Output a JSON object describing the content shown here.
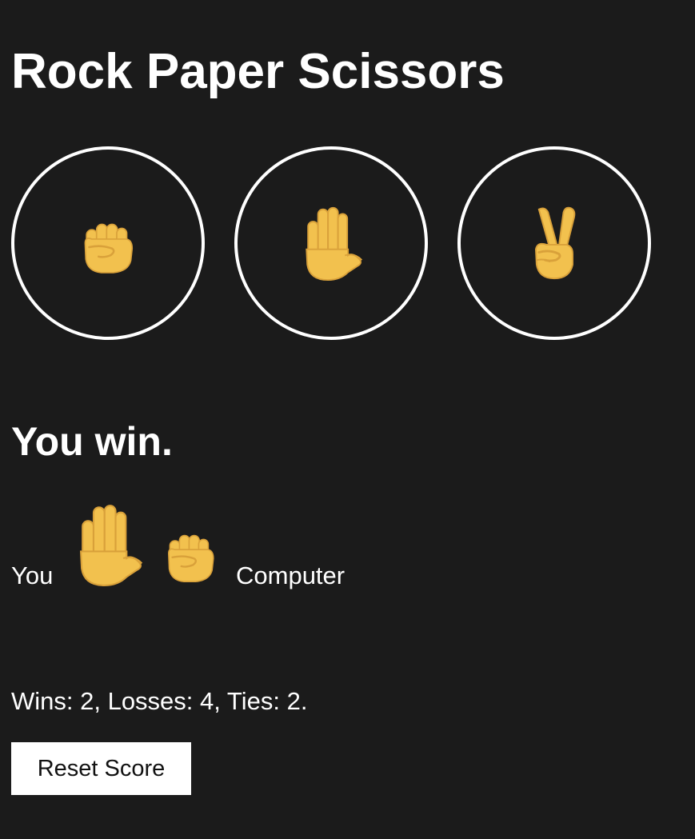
{
  "header": {
    "title": "Rock Paper Scissors"
  },
  "choices": [
    {
      "name": "rock",
      "icon": "raised-fist-icon"
    },
    {
      "name": "paper",
      "icon": "raised-hand-icon"
    },
    {
      "name": "scissors",
      "icon": "victory-hand-icon"
    }
  ],
  "result": {
    "message": "You win.",
    "you_label": "You",
    "computer_label": "Computer",
    "you_choice_icon": "raised-hand-icon",
    "computer_choice_icon": "raised-fist-icon"
  },
  "score": {
    "text": "Wins: 2, Losses: 4, Ties: 2."
  },
  "controls": {
    "reset_label": "Reset Score"
  },
  "colors": {
    "background": "#1b1b1b",
    "text": "#ffffff",
    "emoji_skin": "#f2c14e",
    "emoji_outline": "#d9a13a"
  }
}
